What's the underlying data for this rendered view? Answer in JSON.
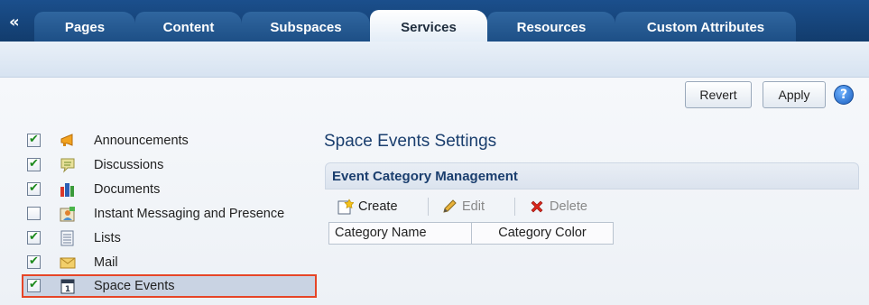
{
  "tabs": {
    "collapse_glyph": "«",
    "items": [
      {
        "label": "Pages"
      },
      {
        "label": "Content"
      },
      {
        "label": "Subspaces"
      },
      {
        "label": "Services"
      },
      {
        "label": "Resources"
      },
      {
        "label": "Custom Attributes"
      }
    ],
    "active": "Services"
  },
  "toolbar": {
    "revert_label": "Revert",
    "apply_label": "Apply",
    "help_glyph": "?"
  },
  "services": [
    {
      "label": "Announcements",
      "checked": true,
      "icon": "megaphone-icon"
    },
    {
      "label": "Discussions",
      "checked": true,
      "icon": "speech-bubble-icon"
    },
    {
      "label": "Documents",
      "checked": true,
      "icon": "books-icon"
    },
    {
      "label": "Instant Messaging and Presence",
      "checked": false,
      "icon": "presence-icon"
    },
    {
      "label": "Lists",
      "checked": true,
      "icon": "list-icon"
    },
    {
      "label": "Mail",
      "checked": true,
      "icon": "envelope-icon"
    },
    {
      "label": "Space Events",
      "checked": true,
      "icon": "calendar-icon",
      "selected": true
    }
  ],
  "settings": {
    "title": "Space Events Settings",
    "panel_title": "Event Category Management",
    "actions": {
      "create": "Create",
      "edit": "Edit",
      "delete": "Delete"
    },
    "columns": [
      "Category Name",
      "Category Color"
    ]
  },
  "colors": {
    "tabbar": "#1b4f8c",
    "highlight_border": "#e64527",
    "check_mark": "#1d8a1d",
    "heading_text": "#1a3e6e"
  }
}
